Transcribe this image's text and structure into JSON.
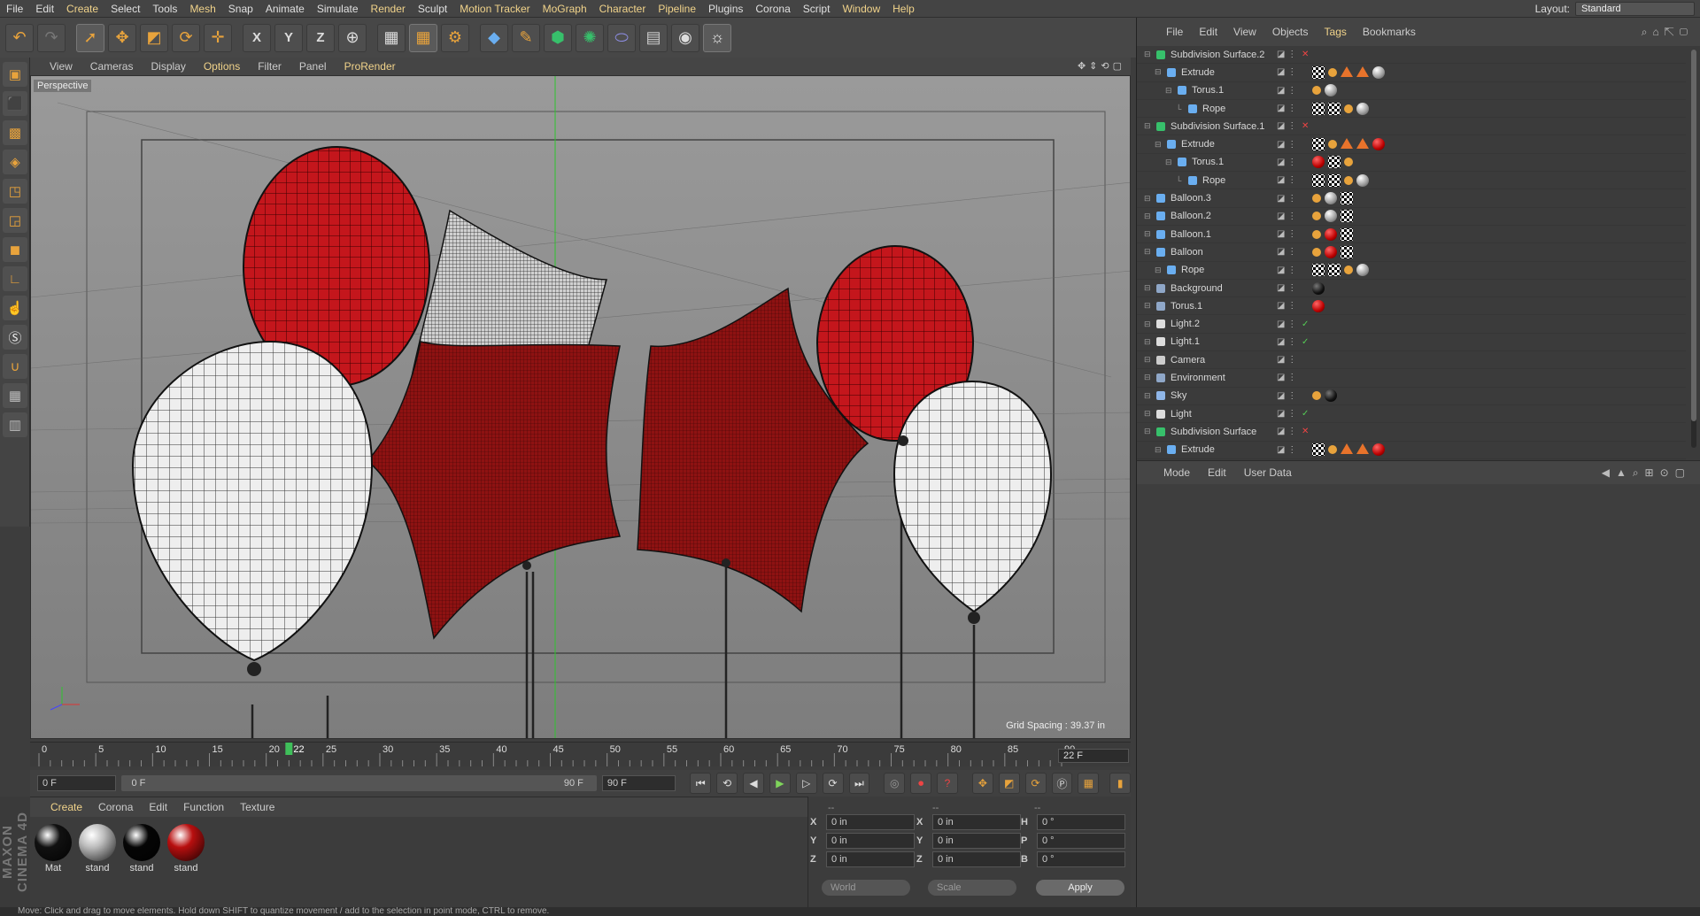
{
  "menubar": {
    "items": [
      "File",
      "Edit",
      "Create",
      "Select",
      "Tools",
      "Mesh",
      "Snap",
      "Animate",
      "Simulate",
      "Render",
      "Sculpt",
      "Motion Tracker",
      "MoGraph",
      "Character",
      "Pipeline",
      "Plugins",
      "Corona",
      "Script",
      "Window",
      "Help"
    ],
    "layout_label": "Layout:",
    "layout_value": "Standard"
  },
  "toolbar": {
    "icons": [
      "undo-icon",
      "redo-icon",
      "live-selection-icon",
      "move-icon",
      "scale-icon",
      "rotate-icon",
      "recent-tool-icon",
      "x-axis-lock-icon",
      "y-axis-lock-icon",
      "z-axis-lock-icon",
      "coordinate-system-icon",
      "render-view-icon",
      "render-picture-viewer-icon",
      "render-settings-icon",
      "cube-primitive-icon",
      "spline-pen-icon",
      "generator-icon",
      "mograph-cloner-icon",
      "deformer-icon",
      "floor-icon",
      "camera-icon",
      "light-icon"
    ],
    "x": "X",
    "y": "Y",
    "z": "Z"
  },
  "viewport": {
    "menu": [
      "View",
      "Cameras",
      "Display",
      "Options",
      "Filter",
      "Panel",
      "ProRender"
    ],
    "active_menu": "Options",
    "label": "Perspective",
    "grid_spacing": "Grid Spacing : 39.37 in"
  },
  "timeline": {
    "ticks": [
      "0",
      "5",
      "10",
      "15",
      "20",
      "25",
      "30",
      "35",
      "40",
      "45",
      "50",
      "55",
      "60",
      "65",
      "70",
      "75",
      "80",
      "85",
      "90"
    ],
    "current_marker": "22",
    "current_frame": "22 F"
  },
  "transport": {
    "start": "0 F",
    "range_start": "0 F",
    "range_end": "90 F",
    "end": "90 F"
  },
  "materials": {
    "menu": [
      "Create",
      "Corona",
      "Edit",
      "Function",
      "Texture"
    ],
    "active_menu": "Create",
    "items": [
      {
        "label": "Mat",
        "color": "#111111"
      },
      {
        "label": "stand",
        "color": "#bcbcbc"
      },
      {
        "label": "stand",
        "color": "#050505"
      },
      {
        "label": "stand",
        "color": "#b80f0f"
      }
    ]
  },
  "coords": {
    "headers": [
      "--",
      "--",
      "--"
    ],
    "rows": [
      {
        "a": "X",
        "av": "0 in",
        "b": "X",
        "bv": "0 in",
        "c": "H",
        "cv": "0 °"
      },
      {
        "a": "Y",
        "av": "0 in",
        "b": "Y",
        "bv": "0 in",
        "c": "P",
        "cv": "0 °"
      },
      {
        "a": "Z",
        "av": "0 in",
        "b": "Z",
        "bv": "0 in",
        "c": "B",
        "cv": "0 °"
      }
    ],
    "world": "World",
    "scale": "Scale",
    "apply": "Apply"
  },
  "logo": "MAXON CINEMA 4D",
  "status": "Move: Click and drag to move elements. Hold down SHIFT to quantize movement / add to the selection in point mode, CTRL to remove.",
  "objects": {
    "menu": [
      "File",
      "Edit",
      "View",
      "Objects",
      "Tags",
      "Bookmarks"
    ],
    "active_menu": "Tags",
    "rows": [
      {
        "name": "Subdivision Surface.2",
        "depth": 0,
        "icon": "#37c06b",
        "flag": "x",
        "tags": []
      },
      {
        "name": "Extrude",
        "depth": 1,
        "icon": "#6aaef0",
        "flag": "",
        "tags": [
          "chk",
          "phong",
          "tri",
          "tri",
          "grey"
        ]
      },
      {
        "name": "Torus.1",
        "depth": 2,
        "icon": "#6aaef0",
        "flag": "",
        "tags": [
          "phong",
          "grey"
        ]
      },
      {
        "name": "Rope",
        "depth": 3,
        "icon": "#6aaef0",
        "flag": "",
        "tags": [
          "chk",
          "chk",
          "phong",
          "grey"
        ]
      },
      {
        "name": "Subdivision Surface.1",
        "depth": 0,
        "icon": "#37c06b",
        "flag": "x",
        "tags": []
      },
      {
        "name": "Extrude",
        "depth": 1,
        "icon": "#6aaef0",
        "flag": "",
        "tags": [
          "chk",
          "phong",
          "tri",
          "tri",
          "red"
        ]
      },
      {
        "name": "Torus.1",
        "depth": 2,
        "icon": "#6aaef0",
        "flag": "",
        "tags": [
          "red",
          "chk",
          "phong"
        ]
      },
      {
        "name": "Rope",
        "depth": 3,
        "icon": "#6aaef0",
        "flag": "",
        "tags": [
          "chk",
          "chk",
          "phong",
          "grey"
        ]
      },
      {
        "name": "Balloon.3",
        "depth": 0,
        "icon": "#6aaef0",
        "flag": "",
        "tags": [
          "phong",
          "grey",
          "chk"
        ]
      },
      {
        "name": "Balloon.2",
        "depth": 0,
        "icon": "#6aaef0",
        "flag": "",
        "tags": [
          "phong",
          "grey",
          "chk"
        ]
      },
      {
        "name": "Balloon.1",
        "depth": 0,
        "icon": "#6aaef0",
        "flag": "",
        "tags": [
          "phong",
          "red",
          "chk"
        ]
      },
      {
        "name": "Balloon",
        "depth": 0,
        "icon": "#6aaef0",
        "flag": "",
        "tags": [
          "phong",
          "red",
          "chk"
        ]
      },
      {
        "name": "Rope",
        "depth": 1,
        "icon": "#6aaef0",
        "flag": "",
        "tags": [
          "chk",
          "chk",
          "phong",
          "grey"
        ]
      },
      {
        "name": "Background",
        "depth": 0,
        "icon": "#8fa7c8",
        "flag": "",
        "tags": [
          "black"
        ]
      },
      {
        "name": "Torus.1",
        "depth": 0,
        "icon": "#8fa7c8",
        "flag": "",
        "tags": [
          "red"
        ]
      },
      {
        "name": "Light.2",
        "depth": 0,
        "icon": "#dddddd",
        "flag": "check",
        "tags": []
      },
      {
        "name": "Light.1",
        "depth": 0,
        "icon": "#dddddd",
        "flag": "check",
        "tags": []
      },
      {
        "name": "Camera",
        "depth": 0,
        "icon": "#cccccc",
        "flag": "",
        "tags": []
      },
      {
        "name": "Environment",
        "depth": 0,
        "icon": "#8fa7c8",
        "flag": "",
        "tags": []
      },
      {
        "name": "Sky",
        "depth": 0,
        "icon": "#8fb6e8",
        "flag": "",
        "tags": [
          "phong",
          "black"
        ]
      },
      {
        "name": "Light",
        "depth": 0,
        "icon": "#dddddd",
        "flag": "check",
        "tags": []
      },
      {
        "name": "Subdivision Surface",
        "depth": 0,
        "icon": "#37c06b",
        "flag": "x",
        "tags": []
      },
      {
        "name": "Extrude",
        "depth": 1,
        "icon": "#6aaef0",
        "flag": "",
        "tags": [
          "chk",
          "phong",
          "tri",
          "tri",
          "red"
        ]
      }
    ]
  },
  "attributes": {
    "menu": [
      "Mode",
      "Edit",
      "User Data"
    ]
  }
}
